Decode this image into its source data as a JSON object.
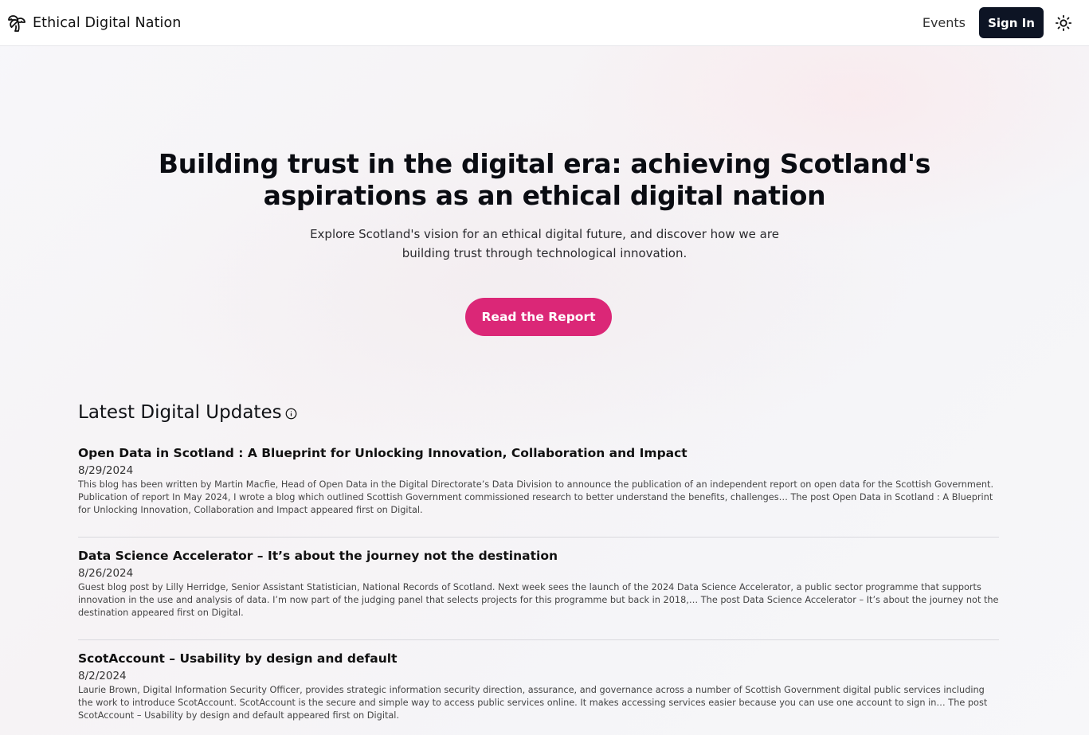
{
  "header": {
    "brand": "Ethical Digital Nation",
    "nav_events": "Events",
    "sign_in": "Sign In"
  },
  "hero": {
    "title": "Building trust in the digital era: achieving Scotland's aspirations as an ethical digital nation",
    "subtitle": "Explore Scotland's vision for an ethical digital future, and discover how we are building trust through technological innovation.",
    "cta": "Read the Report"
  },
  "updates": {
    "heading": "Latest Digital Updates",
    "posts": [
      {
        "title": "Open Data in Scotland : A Blueprint for Unlocking Innovation, Collaboration and Impact",
        "date": "8/29/2024",
        "summary": "This blog has been written by Martin Macfie, Head of Open Data in the Digital Directorate’s Data Division to announce the publication of an independent report on open data for the Scottish Government. Publication of report In May 2024, I wrote a blog which outlined Scottish Government commissioned research to better understand the benefits, challenges… The post Open Data in Scotland : A Blueprint for Unlocking Innovation, Collaboration and Impact appeared first on Digital."
      },
      {
        "title": "Data Science Accelerator – It’s about the journey not the destination",
        "date": "8/26/2024",
        "summary": "Guest blog post by Lilly Herridge, Senior Assistant Statistician, National Records of Scotland. Next week sees the launch of the 2024 Data Science Accelerator, a public sector programme that supports innovation in the use and analysis of data. I’m now part of the judging panel that selects projects for this programme but back in 2018,… The post Data Science Accelerator – It’s about the journey not the destination appeared first on Digital."
      },
      {
        "title": "ScotAccount – Usability by design and default",
        "date": "8/2/2024",
        "summary": "Laurie Brown, Digital Information Security Officer, provides strategic information security direction, assurance, and governance across a number of Scottish Government digital public services including the work to introduce ScotAccount. ScotAccount is the secure and simple way to access public services online. It makes accessing services easier because you can use one account to sign in… The post ScotAccount – Usability by design and default appeared first on Digital."
      }
    ]
  },
  "icons": {
    "brand": "palm-tree-icon",
    "theme": "sun-icon",
    "info": "info-icon"
  },
  "colors": {
    "accent": "#db2777",
    "sign_in_bg": "#0d1424"
  }
}
